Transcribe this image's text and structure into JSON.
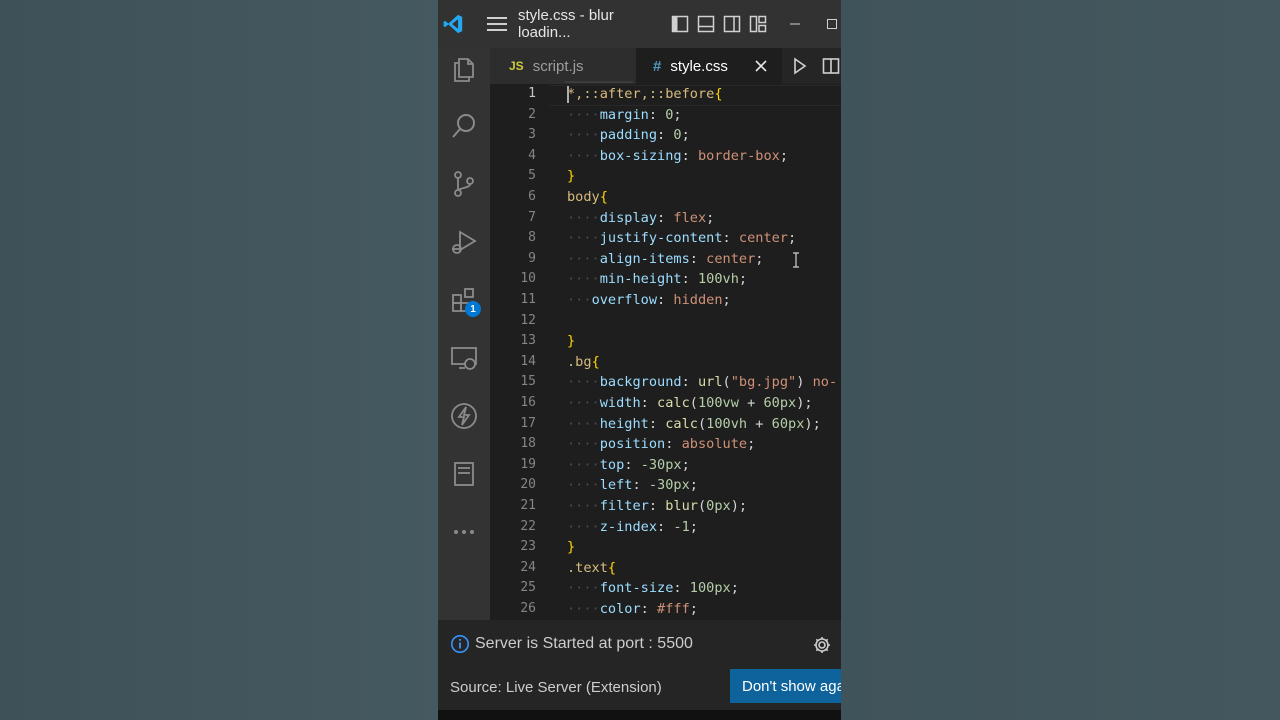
{
  "titlebar": {
    "title": "style.css - blur loadin...",
    "icons": [
      "vscode-logo-icon",
      "menu-icon",
      "toggle-primary-sidebar-icon",
      "toggle-panel-icon",
      "toggle-secondary-sidebar-icon",
      "customize-layout-icon",
      "minimize-icon",
      "maximize-icon"
    ]
  },
  "activity_bar": {
    "items": [
      {
        "name": "explorer-icon"
      },
      {
        "name": "search-icon"
      },
      {
        "name": "source-control-icon"
      },
      {
        "name": "run-debug-icon"
      },
      {
        "name": "extensions-icon",
        "badge": "1"
      },
      {
        "name": "remote-explorer-icon"
      },
      {
        "name": "lightning-icon"
      },
      {
        "name": "notebook-icon"
      },
      {
        "name": "more-icon"
      }
    ]
  },
  "tabs": [
    {
      "icon_text": "JS",
      "label": "script.js",
      "active": false
    },
    {
      "icon_text": "#",
      "label": "style.css",
      "active": true
    }
  ],
  "tab_actions": [
    "run-icon",
    "split-editor-icon"
  ],
  "editor": {
    "lines": [
      {
        "n": "1",
        "indent": 0,
        "parts": [
          [
            "sel",
            "*,::after,::before"
          ],
          [
            "br",
            "{"
          ]
        ]
      },
      {
        "n": "2",
        "indent": 2,
        "parts": [
          [
            "prop",
            "margin"
          ],
          [
            "p",
            ": "
          ],
          [
            "num",
            "0"
          ],
          [
            "p",
            ";"
          ]
        ]
      },
      {
        "n": "3",
        "indent": 2,
        "parts": [
          [
            "prop",
            "padding"
          ],
          [
            "p",
            ": "
          ],
          [
            "num",
            "0"
          ],
          [
            "p",
            ";"
          ]
        ]
      },
      {
        "n": "4",
        "indent": 2,
        "parts": [
          [
            "prop",
            "box-sizing"
          ],
          [
            "p",
            ": "
          ],
          [
            "val",
            "border-box"
          ],
          [
            "p",
            ";"
          ]
        ]
      },
      {
        "n": "5",
        "indent": 0,
        "parts": [
          [
            "br",
            "}"
          ]
        ]
      },
      {
        "n": "6",
        "indent": 0,
        "parts": [
          [
            "sel",
            "body"
          ],
          [
            "br",
            "{"
          ]
        ]
      },
      {
        "n": "7",
        "indent": 2,
        "parts": [
          [
            "prop",
            "display"
          ],
          [
            "p",
            ": "
          ],
          [
            "val",
            "flex"
          ],
          [
            "p",
            ";"
          ]
        ]
      },
      {
        "n": "8",
        "indent": 2,
        "parts": [
          [
            "prop",
            "justify-content"
          ],
          [
            "p",
            ": "
          ],
          [
            "val",
            "center"
          ],
          [
            "p",
            ";"
          ]
        ]
      },
      {
        "n": "9",
        "indent": 2,
        "parts": [
          [
            "prop",
            "align-items"
          ],
          [
            "p",
            ": "
          ],
          [
            "val",
            "center"
          ],
          [
            "p",
            ";"
          ]
        ]
      },
      {
        "n": "10",
        "indent": 2,
        "parts": [
          [
            "prop",
            "min-height"
          ],
          [
            "p",
            ": "
          ],
          [
            "num",
            "100vh"
          ],
          [
            "p",
            ";"
          ]
        ]
      },
      {
        "n": "11",
        "indent": 1,
        "parts": [
          [
            "prop",
            "overflow"
          ],
          [
            "p",
            ": "
          ],
          [
            "val",
            "hidden"
          ],
          [
            "p",
            ";"
          ]
        ]
      },
      {
        "n": "12",
        "indent": 0,
        "parts": []
      },
      {
        "n": "13",
        "indent": 0,
        "parts": [
          [
            "br",
            "}"
          ]
        ]
      },
      {
        "n": "14",
        "indent": 0,
        "parts": [
          [
            "sel",
            ".bg"
          ],
          [
            "br",
            "{"
          ]
        ]
      },
      {
        "n": "15",
        "indent": 2,
        "parts": [
          [
            "prop",
            "background"
          ],
          [
            "p",
            ": "
          ],
          [
            "fn",
            "url"
          ],
          [
            "p",
            "("
          ],
          [
            "val",
            "\"bg.jpg\""
          ],
          [
            "p",
            ") "
          ],
          [
            "val",
            "no-"
          ]
        ]
      },
      {
        "n": "16",
        "indent": 2,
        "parts": [
          [
            "prop",
            "width"
          ],
          [
            "p",
            ": "
          ],
          [
            "fn",
            "calc"
          ],
          [
            "p",
            "("
          ],
          [
            "num",
            "100vw"
          ],
          [
            "p",
            " + "
          ],
          [
            "num",
            "60px"
          ],
          [
            "p",
            ");"
          ]
        ]
      },
      {
        "n": "17",
        "indent": 2,
        "parts": [
          [
            "prop",
            "height"
          ],
          [
            "p",
            ": "
          ],
          [
            "fn",
            "calc"
          ],
          [
            "p",
            "("
          ],
          [
            "num",
            "100vh"
          ],
          [
            "p",
            " + "
          ],
          [
            "num",
            "60px"
          ],
          [
            "p",
            ");"
          ]
        ]
      },
      {
        "n": "18",
        "indent": 2,
        "parts": [
          [
            "prop",
            "position"
          ],
          [
            "p",
            ": "
          ],
          [
            "val",
            "absolute"
          ],
          [
            "p",
            ";"
          ]
        ]
      },
      {
        "n": "19",
        "indent": 2,
        "parts": [
          [
            "prop",
            "top"
          ],
          [
            "p",
            ": "
          ],
          [
            "num",
            "-30px"
          ],
          [
            "p",
            ";"
          ]
        ]
      },
      {
        "n": "20",
        "indent": 2,
        "parts": [
          [
            "prop",
            "left"
          ],
          [
            "p",
            ": "
          ],
          [
            "num",
            "-30px"
          ],
          [
            "p",
            ";"
          ]
        ]
      },
      {
        "n": "21",
        "indent": 2,
        "parts": [
          [
            "prop",
            "filter"
          ],
          [
            "p",
            ": "
          ],
          [
            "fn",
            "blur"
          ],
          [
            "p",
            "("
          ],
          [
            "num",
            "0px"
          ],
          [
            "p",
            ");"
          ]
        ]
      },
      {
        "n": "22",
        "indent": 2,
        "parts": [
          [
            "prop",
            "z-index"
          ],
          [
            "p",
            ": "
          ],
          [
            "num",
            "-1"
          ],
          [
            "p",
            ";"
          ]
        ]
      },
      {
        "n": "23",
        "indent": 0,
        "parts": [
          [
            "br",
            "}"
          ]
        ]
      },
      {
        "n": "24",
        "indent": 0,
        "parts": [
          [
            "sel",
            ".text"
          ],
          [
            "br",
            "{"
          ]
        ]
      },
      {
        "n": "25",
        "indent": 2,
        "parts": [
          [
            "prop",
            "font-size"
          ],
          [
            "p",
            ": "
          ],
          [
            "num",
            "100px"
          ],
          [
            "p",
            ";"
          ]
        ]
      },
      {
        "n": "26",
        "indent": 2,
        "parts": [
          [
            "prop",
            "color"
          ],
          [
            "p",
            ": "
          ],
          [
            "val",
            "#fff"
          ],
          [
            "p",
            ";"
          ]
        ]
      }
    ]
  },
  "notification": {
    "message": "Server is Started at port : 5500",
    "source": "Source: Live Server (Extension)",
    "button": "Don't show aga"
  },
  "colors": {
    "accent": "#0e639c",
    "badge": "#0078d4",
    "vscode_blue": "#23a9f2",
    "js_yellow": "#cbcb41",
    "css_blue": "#519aba"
  }
}
